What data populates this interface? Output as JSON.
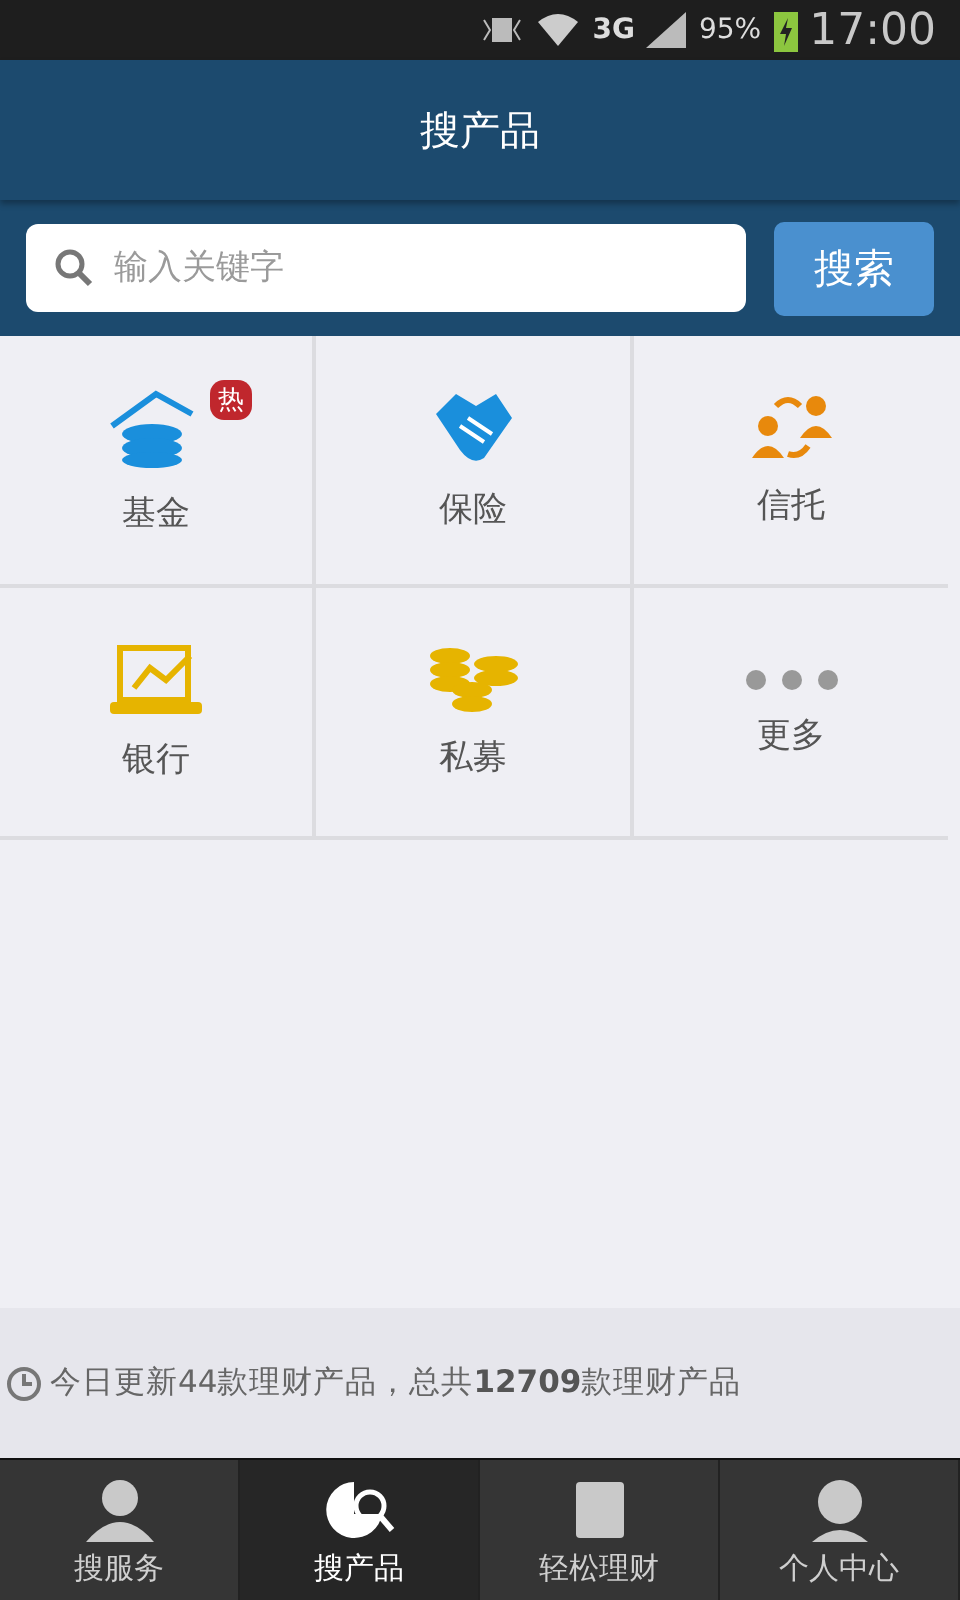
{
  "status_bar": {
    "network": "3G",
    "battery": "95%",
    "time": "17:00"
  },
  "header": {
    "title": "搜产品"
  },
  "search": {
    "placeholder": "输入关键字",
    "button": "搜索"
  },
  "categories": [
    {
      "label": "基金",
      "badge": "热"
    },
    {
      "label": "保险"
    },
    {
      "label": "信托"
    },
    {
      "label": "银行"
    },
    {
      "label": "私募"
    },
    {
      "label": "更多"
    }
  ],
  "info": "今日更新44款理财产品，总共**12709**款理财产品",
  "tabs": [
    {
      "label": "搜服务",
      "selected": false
    },
    {
      "label": "搜产品",
      "selected": true
    },
    {
      "label": "轻松理财",
      "selected": false
    },
    {
      "label": "个人中心",
      "selected": false
    }
  ]
}
